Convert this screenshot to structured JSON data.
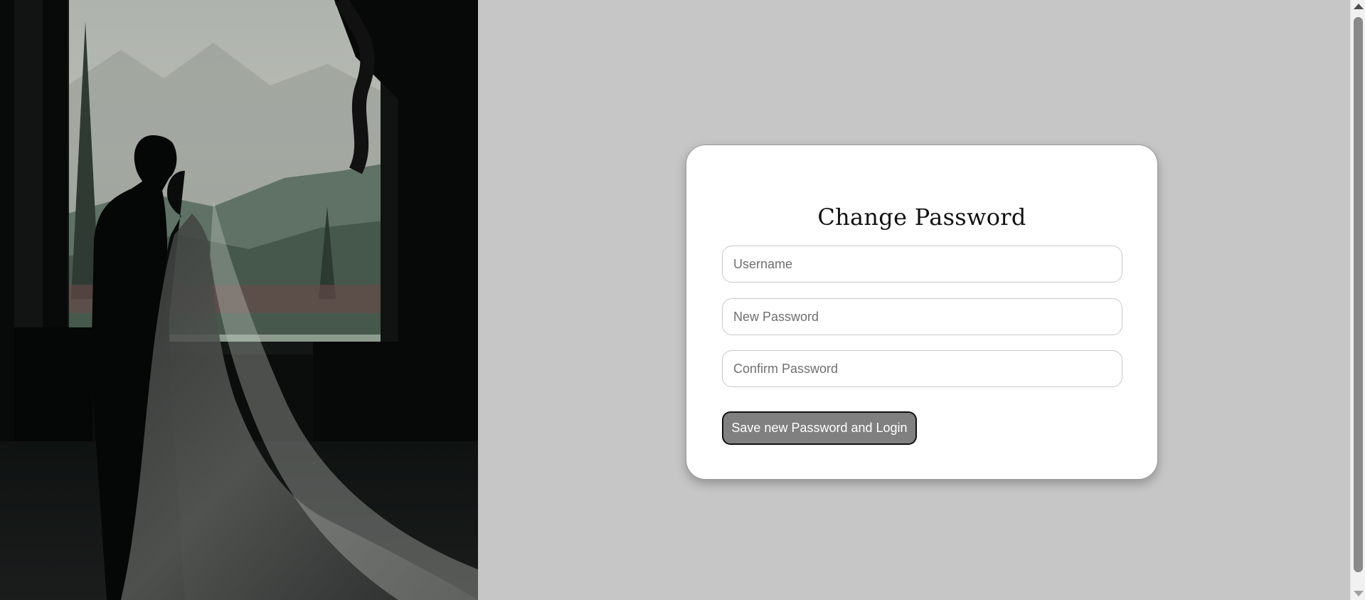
{
  "hero": {
    "image": "wedding-couple-silhouette"
  },
  "form": {
    "title": "Change Password",
    "username_placeholder": "Username",
    "new_password_placeholder": "New Password",
    "confirm_password_placeholder": "Confirm Password",
    "submit_label": "Save new Password and Login"
  },
  "colors": {
    "page_background": "#c6c6c6",
    "card_background": "#ffffff",
    "button_background": "#808080",
    "button_text": "#ffffff"
  }
}
